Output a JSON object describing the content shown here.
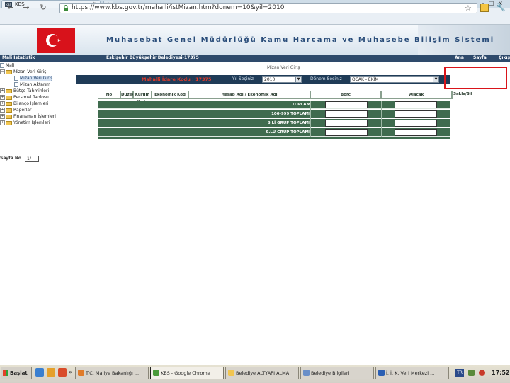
{
  "browser": {
    "tab_title": "KBS",
    "tab_favicon_text": "KBS",
    "tab_close": "×",
    "new_tab": "+",
    "url": "https://www.kbs.gov.tr/mahalli/istMizan.htm?donem=10&yil=2010",
    "nav_icons": [
      "back-icon",
      "forward-icon",
      "reload-icon",
      "lock-icon",
      "star-icon",
      "page-icon",
      "wrench-icon"
    ]
  },
  "site": {
    "system_title": "Muhasebat Genel Müdürlüğü Kamu Harcama ve Muhasebe Bilişim Sistemi",
    "nav": {
      "section": "Mali İstatistik",
      "org": "Eskişehir Büyükşehir Belediyesi-17375",
      "links": [
        "Ana",
        "Sayfa",
        "Çıkış"
      ]
    }
  },
  "tree": {
    "items": [
      {
        "label": "Mali",
        "type": "root"
      },
      {
        "label": "Mizan Veri Giriş",
        "type": "folder"
      },
      {
        "label": "Mizan Veri Giriş",
        "type": "doc",
        "selected": true
      },
      {
        "label": "Mizan Aktarım",
        "type": "doc"
      },
      {
        "label": "Bütçe Tahminleri",
        "type": "folder"
      },
      {
        "label": "Personel Tablosu",
        "type": "folder"
      },
      {
        "label": "Bilanço İşlemleri",
        "type": "folder"
      },
      {
        "label": "Raporlar",
        "type": "folder"
      },
      {
        "label": "Finansman İşlemleri",
        "type": "folder"
      },
      {
        "label": "Yönetim İşlemleri",
        "type": "folder"
      }
    ]
  },
  "form": {
    "breadcrumb": "Mizan Veri Giriş",
    "kurum": "Mahalli İdare Kodu : 17375",
    "yil_label": "Yıl Seçiniz",
    "yil_value": "2010",
    "donem_label": "Dönem Seçiniz",
    "donem_value": "OCAK - EKİM"
  },
  "table": {
    "headers": [
      "No",
      "Düzey",
      "Kurum Kodu",
      "Ekonomik Kod",
      "Hesap Adı / Ekonomik Adı",
      "Borç",
      "Alacak",
      "Sakla/Sil"
    ],
    "rows": [
      {
        "label": "TOPLAM"
      },
      {
        "label": "100-999 TOPLAMI"
      },
      {
        "label": "8.Lİ GRUP TOPLAMI"
      },
      {
        "label": "9.LU GRUP TOPLAMI"
      }
    ]
  },
  "paging": {
    "label": "Sayfa No",
    "value": "1/"
  },
  "taskbar": {
    "start": "Başlat",
    "more": "»",
    "buttons": [
      {
        "label": "T.C. Maliye Bakanlığı ...",
        "active": false
      },
      {
        "label": "KBS - Google Chrome",
        "active": true
      },
      {
        "label": "Belediye ALTYAPI ALMA",
        "active": false
      },
      {
        "label": "Belediye Bilgileri",
        "active": false
      },
      {
        "label": "İ. İ. K. Veri Merkezi ...",
        "active": false
      }
    ],
    "lang": "TR",
    "clock": "17:52"
  },
  "colors": {
    "navbar": "#2e4a6b",
    "filterbar": "#1f3b57",
    "grid_rows": "#3f6b4e",
    "highlight_box": "#d9141a",
    "kurum_text": "#e23a2a"
  }
}
